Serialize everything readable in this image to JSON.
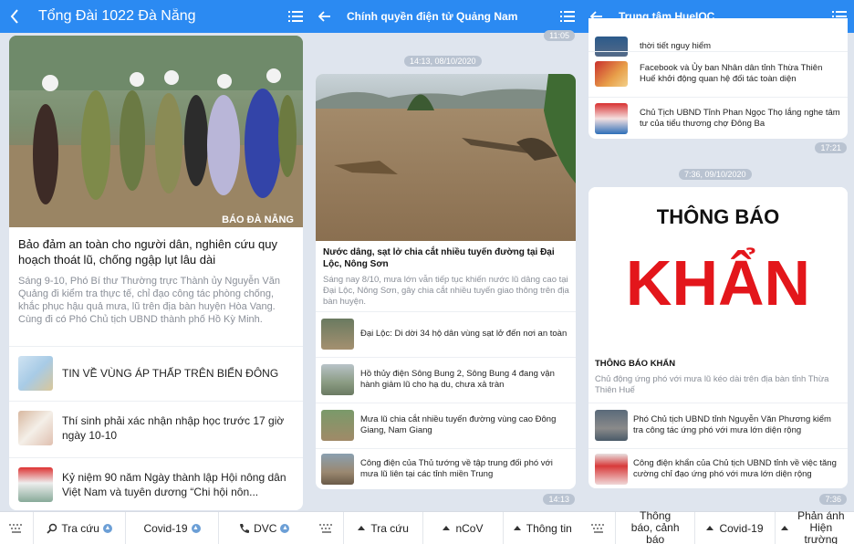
{
  "s1": {
    "header_title": "Tổng Đài 1022 Đà Nẵng",
    "photo_watermark": "BÁO ĐÀ NẴNG",
    "featured_title": "Bảo đảm an toàn cho người dân, nghiên cứu quy hoạch thoát lũ, chống ngập lụt lâu dài",
    "featured_summary": "Sáng 9-10, Phó Bí thư Thường trực Thành ủy Nguyễn Văn Quảng đi kiểm tra thực tế, chỉ đạo công tác phòng chống, khắc phục hậu quả mưa, lũ trên địa bàn huyện Hòa Vang. Cùng đi có Phó Chủ tịch UBND thành phố Hồ Kỳ Minh.",
    "items": [
      {
        "label": "TIN VỀ VÙNG ÁP THẤP TRÊN BIỂN ĐÔNG"
      },
      {
        "label": "Thí sinh phải xác nhận nhập học trước 17 giờ ngày 10-10"
      },
      {
        "label": "Kỷ niệm 90 năm Ngày thành lập Hội nông dân Việt Nam và tuyên dương “Chi hội nôn..."
      }
    ],
    "footer": {
      "b1": "Tra cứu",
      "b2": "Covid-19",
      "b3": "DVC"
    }
  },
  "s2": {
    "header_title": "Chính quyền điện tử Quảng Nam",
    "prev_time": "11:05",
    "date_pill": "14:13, 08/10/2020",
    "featured_title": "Nước dâng, sạt lở chia cắt nhiều tuyến đường tại Đại Lộc, Nông Sơn",
    "featured_summary": "Sáng nay 8/10, mưa lớn vẫn tiếp tục khiến nước lũ dâng cao tại Đại Lộc, Nông Sơn, gây chia cắt nhiều tuyến giao thông trên địa bàn huyện.",
    "items": [
      {
        "label": "Đại Lộc: Di dời 34 hộ dân vùng sạt lở đến nơi an toàn"
      },
      {
        "label": "Hồ thủy điện Sông Bung 2, Sông Bung 4 đang vận hành giảm lũ cho hạ du, chưa xả tràn"
      },
      {
        "label": "Mưa lũ chia cắt nhiều tuyến đường vùng cao Đông Giang, Nam Giang"
      },
      {
        "label": "Công điện của Thủ tướng về tập trung đối phó với mưa lũ liên tại các tỉnh miền Trung"
      }
    ],
    "time": "14:13",
    "footer": {
      "b1": "Tra cứu",
      "b2": "nCoV",
      "b3": "Thông tin"
    }
  },
  "s3": {
    "header_title": "Trung tâm HueIOC",
    "top_items": [
      {
        "label": "thời tiết nguy hiểm"
      },
      {
        "label": "Facebook và Ủy ban Nhân dân tỉnh Thừa Thiên Huế khởi động quan hệ đối tác toàn diện"
      },
      {
        "label": "Chủ Tịch UBND Tỉnh Phan Ngọc Thọ lắng nghe tâm tư của tiểu thương chợ Đông Ba"
      }
    ],
    "time1": "17:21",
    "date_pill": "7:36, 09/10/2020",
    "notice_line1": "THÔNG BÁO",
    "notice_line2": "KHẨN",
    "featured_title": "THÔNG BÁO KHẨN",
    "featured_summary": "Chủ động ứng phó với mưa lũ kéo dài trên địa bàn tỉnh Thừa Thiên Huế",
    "items": [
      {
        "label": "Phó Chủ tịch UBND tỉnh Nguyễn Văn Phương kiểm tra công tác ứng phó với mưa lớn diện rộng"
      },
      {
        "label": "Công điện khẩn của Chủ tịch UBND tỉnh về việc tăng cường chỉ đạo ứng phó với mưa lớn diện rộng"
      }
    ],
    "time2": "7:36",
    "footer": {
      "b1": "Thông báo, cảnh báo",
      "b2": "Covid-19",
      "b3": "Phản ánh Hiện trường"
    }
  },
  "colors": {
    "header_blue": "#2b8af2",
    "notice_red": "#e3161b",
    "background": "#dfe5ee"
  },
  "icons": [
    "back-arrow-icon",
    "hamburger-menu-icon",
    "keyboard-icon",
    "search-icon",
    "phone-icon",
    "caret-up-icon"
  ]
}
